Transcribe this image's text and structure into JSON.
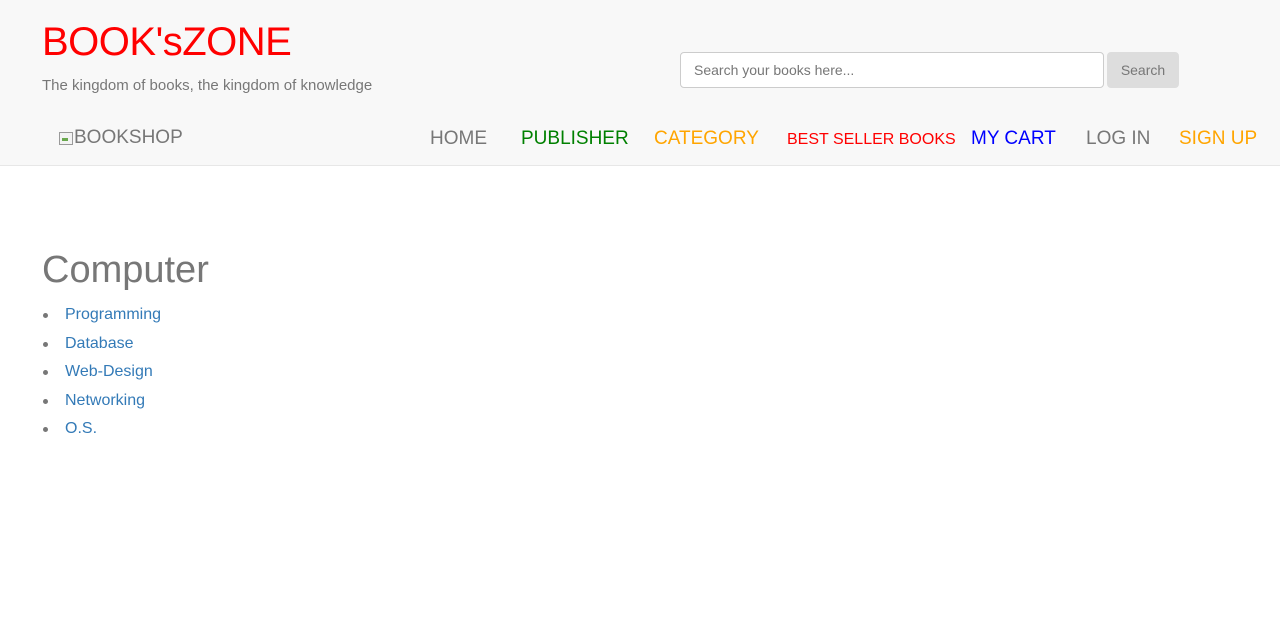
{
  "brand": {
    "title": "BOOK'sZONE",
    "tagline": "The kingdom of books, the kingdom of knowledge",
    "title_color": "#ff0000"
  },
  "search": {
    "placeholder": "Search your books here...",
    "value": "",
    "button_label": "Search"
  },
  "logo": {
    "alt_text": "BOOKSHOP",
    "icon": "broken-image-icon"
  },
  "nav": {
    "home": "HOME",
    "publisher": "PUBLISHER",
    "category": "CATEGORY",
    "best_seller": "BEST SELLER BOOKS",
    "my_cart": "MY CART",
    "log_in": "LOG IN",
    "sign_up": "SIGN UP",
    "colors": {
      "home": "#777777",
      "publisher": "#008000",
      "category": "#ffa500",
      "best_seller": "#ff0000",
      "my_cart": "#0000ff",
      "log_in": "#777777",
      "sign_up": "#ffa500"
    }
  },
  "main": {
    "title": "Computer",
    "items": [
      {
        "label": "Programming"
      },
      {
        "label": "Database"
      },
      {
        "label": "Web-Design"
      },
      {
        "label": "Networking"
      },
      {
        "label": "O.S."
      }
    ],
    "link_color": "#337ab7"
  }
}
